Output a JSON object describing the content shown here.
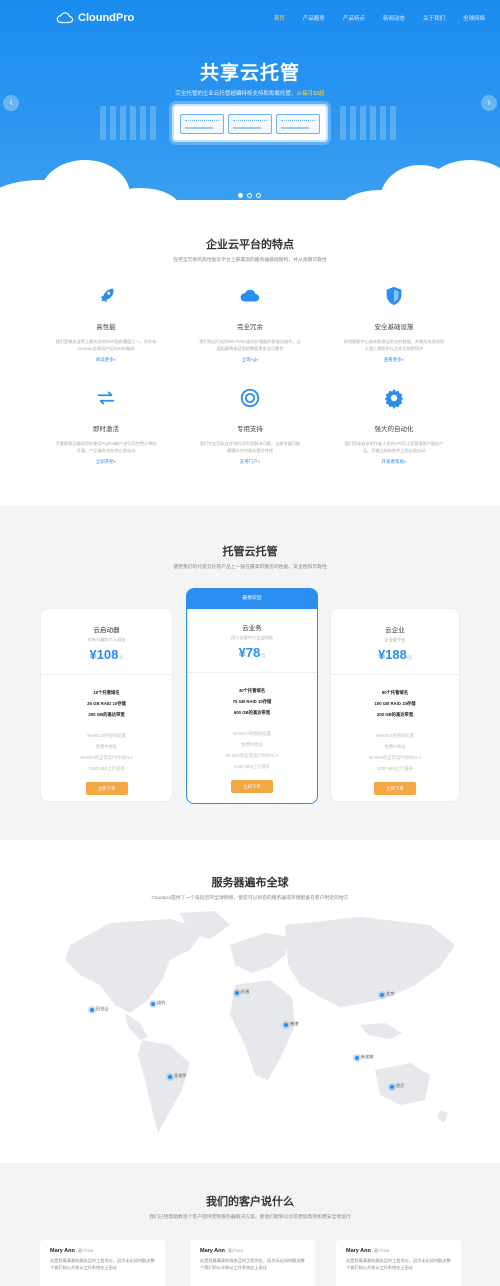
{
  "brand": {
    "name": "CloundPro"
  },
  "nav": [
    "首页",
    "产品服务",
    "产品特点",
    "新闻动态",
    "关于我们",
    "全球网络"
  ],
  "hero": {
    "title": "共享云托管",
    "subtitle": "完全托管的企业云托管超编特栎支持和免载托管，",
    "subtitle_highlight": "从每月$8起",
    "prev_label": "‹",
    "next_label": "›"
  },
  "features": {
    "title": "企业云平台的特点",
    "subtitle": "在完全冗余的高性能云平台上部署您的服务器基础架构，并从真期可靠性",
    "items": [
      {
        "name": "高性能",
        "desc": "我们是最具业界上最先进的SSD固态硬盘之一，另外有Amazon全球用户区的SSD服务",
        "link": "阅读更多»",
        "icon": "rocket-icon"
      },
      {
        "name": "完全冗余",
        "desc": "我们所运行在的MD RAID连续存储器的基础设施中，全面组建将保证您的数据更安全可靠性",
        "link": "立等Ajj»",
        "icon": "cloud-icon"
      },
      {
        "name": "安全基础设施",
        "desc": "采用智能中心具有和保证前台的数据，并敢用先进的防火墙入侵防护以及安全加密保护",
        "link": "查看更多»",
        "icon": "shield-icon"
      },
      {
        "name": "即时激活",
        "desc": "大量管理员确保您在使用PayPal账户进行后付费订单的开通，产品服务也在线立即启动",
        "link": "立即开始»",
        "icon": "exchange-icon"
      },
      {
        "name": "专用支持",
        "desc": "我们专业团队在任何时间为您解决问题，让解决器可能遭遇的任何服务提升并使",
        "link": "支持门户»",
        "icon": "lifebuoy-icon"
      },
      {
        "name": "强大的自动化",
        "desc": "我们用来自多的作者人员的API可让您管理账户服务产品，开通立即有效并立即全面自动",
        "link": "开发者帮助»",
        "icon": "gear-icon"
      }
    ]
  },
  "pricing": {
    "title": "托管云托管",
    "subtitle": "使用我们的托管云托管产品上一般在最高的服务的性能、安全性和可靠性",
    "plans": [
      {
        "name": "云启动器",
        "sub": "对有兴趣的个人网站",
        "price": "¥108",
        "unit": "/月",
        "specs": [
          "10个托管域名",
          "25 GB RAID 10存储",
          "200 GB的高达带宽"
        ],
        "extras": [
          "WHMCS的密码设置",
          "免费IP地址",
          "99.90%的正常运行时间SLA",
          "1000 Mbit上行速率"
        ],
        "button": "立即下单",
        "featured": false,
        "badge": ""
      },
      {
        "name": "云业务",
        "sub": "用于运营中小企业网站",
        "price": "¥78",
        "unit": "/月",
        "specs": [
          "30个托管域名",
          "75 GB RAID 10存储",
          "600 GB的高达带宽"
        ],
        "extras": [
          "WHMCS的密码设置",
          "免费IP地址",
          "99.90%的正常运行时间SLA",
          "1000 Mbit上行速率"
        ],
        "button": "立即下单",
        "featured": true,
        "badge": "最受欢迎"
      },
      {
        "name": "云企业",
        "sub": "企业级平台",
        "price": "¥188",
        "unit": "/月",
        "specs": [
          "90个托管域名",
          "100 GB RAID 10存储",
          "200 GB的高达带宽"
        ],
        "extras": [
          "WHMCS的密码设置",
          "免费IP地址",
          "99.90%的正常运行时间SLA",
          "1000 Mbit上行速率"
        ],
        "button": "立即下单",
        "featured": false,
        "badge": ""
      }
    ]
  },
  "map": {
    "title": "服务器遍布全球",
    "subtitle": "Cloudpro提供了一个低延迟的全球网络，使您可以将您的服务器或存储配备在客户附近的地方",
    "locations": [
      "旧金山",
      "纽约",
      "伦敦",
      "北京",
      "香港",
      "新加坡",
      "悉尼",
      "圣保罗"
    ]
  },
  "testimonials": {
    "title": "我们的客户说什么",
    "subtitle": "我们已经帮助数百个客户提供定制服务器解决方案，使他们能够以比前更加高效和更安全地运行",
    "items": [
      {
        "name": "Mary Ann",
        "role": "客户ceo",
        "text": "这是我最满意的服务且的工程供应，因为无论如何解决整个我们的公开商从工作系统在上面化"
      },
      {
        "name": "Mary Ann",
        "role": "客户ceo",
        "text": "这是我最满意的服务且的工程供应，因为无论如何解决整个我们的公开商从工作系统在上面化"
      },
      {
        "name": "Mary Ann",
        "role": "客户ceo",
        "text": "这是我最满意的服务且的工程供应，因为无论如何解决整个我们的公开商从工作系统在上面化"
      }
    ]
  },
  "colors": {
    "primary": "#2a8df0",
    "accent": "#f4a742",
    "highlight": "#ffd34d"
  }
}
